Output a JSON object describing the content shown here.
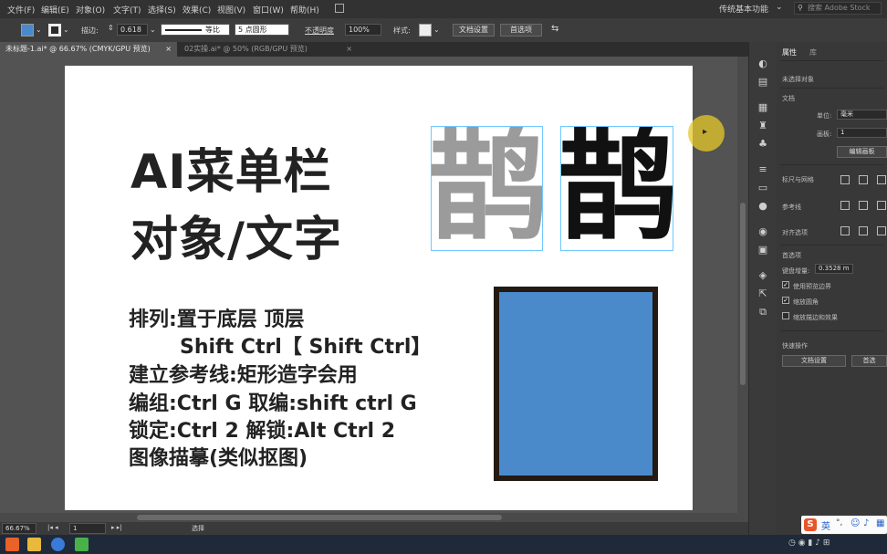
{
  "menu": {
    "items": [
      "文件(F)",
      "编辑(E)",
      "对象(O)",
      "文字(T)",
      "选择(S)",
      "效果(C)",
      "视图(V)",
      "窗口(W)",
      "帮助(H)"
    ],
    "workspace": "传统基本功能",
    "search_placeholder": "搜索 Adobe Stock"
  },
  "control": {
    "stroke_label": "描边:",
    "stroke_value": "0.618",
    "profile_label": "等比",
    "brush_label": "5 点圆形",
    "opacity_label": "不透明度",
    "opacity_value": "100%",
    "style_label": "样式:",
    "doc_setup_button": "文档设置",
    "prefs_button": "首选项",
    "fill_color": "#4a8acb"
  },
  "tabs": [
    {
      "label": "未标题-1.ai* @ 66.67% (CMYK/GPU 预览)",
      "close": "×"
    },
    {
      "label": "02实操.ai* @ 50% (RGB/GPU 预览)",
      "close": "×"
    }
  ],
  "artboard": {
    "title_line1": "AI菜单栏",
    "title_line2": "对象/文字",
    "glyph_char": "鹊",
    "lines": [
      "排列:置于底层      顶层",
      "Shift Ctrl【    Shift Ctrl】",
      "建立参考线:矩形造字会用",
      "编组:Ctrl G  取编:shift ctrl G",
      "锁定:Ctrl 2   解锁:Alt Ctrl 2",
      "图像描摹(类似抠图)"
    ],
    "rect_fill": "#4a8acb",
    "rect_stroke": "#231a12"
  },
  "panel": {
    "tab_props": "属性",
    "tab_lib": "库",
    "no_selection": "未选择对象",
    "doc_section": "文档",
    "units_label": "单位:",
    "units_value": "毫米",
    "artboard_label": "画板:",
    "artboard_value": "1",
    "edit_artboard_button": "编辑画板",
    "rulers_label": "标尺与网格",
    "guides_label": "参考线",
    "snap_label": "对齐选项",
    "prefs_section": "首选项",
    "key_increment_label": "键盘增量:",
    "key_increment_value": "0.3528 m",
    "check_preview_bounds": "使用预览边界",
    "check_scale_corners": "缩放圆角",
    "check_scale_strokes": "缩放描边和效果",
    "quick_actions": "快速操作",
    "doc_setup_button": "文档设置",
    "prefs_button": "首选"
  },
  "status": {
    "zoom": "66.67%",
    "artboard_num": "1",
    "tool": "选择"
  }
}
